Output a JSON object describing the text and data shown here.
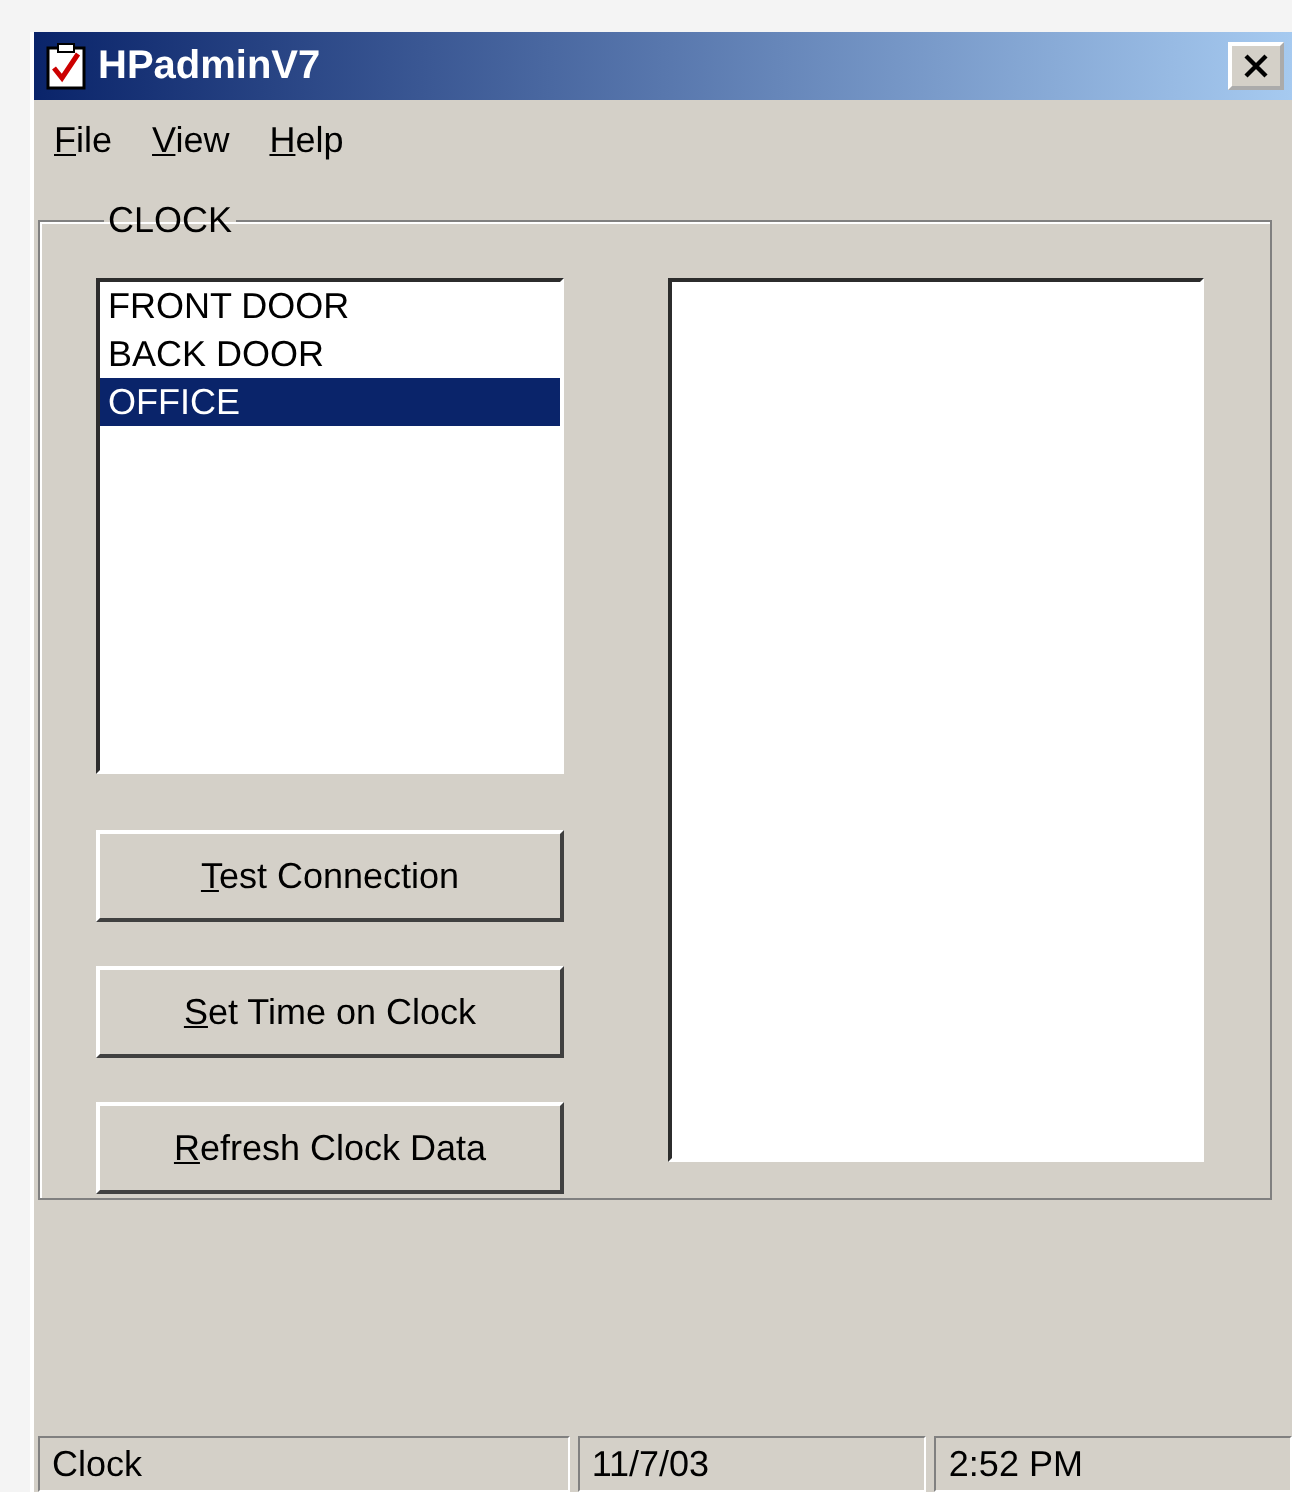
{
  "window": {
    "title": "HPadminV7"
  },
  "menu": [
    "File",
    "View",
    "Help"
  ],
  "group": {
    "title": "CLOCK"
  },
  "clocks": [
    {
      "label": "FRONT DOOR",
      "selected": false
    },
    {
      "label": "BACK DOOR",
      "selected": false
    },
    {
      "label": "OFFICE",
      "selected": true
    }
  ],
  "buttons": [
    "Test Connection",
    "Set Time on Clock",
    "Refresh Clock Data"
  ],
  "status_bar": [
    "Clock",
    "11/7/03",
    "2:52 PM"
  ]
}
